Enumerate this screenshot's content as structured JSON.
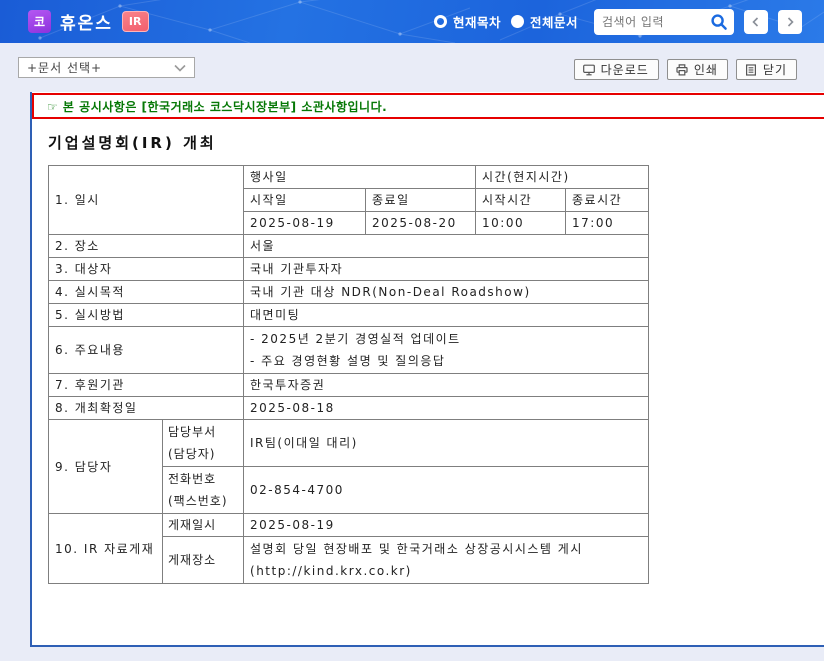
{
  "header": {
    "market_badge": "코",
    "company_name": "휴온스",
    "ir_badge": "IR",
    "radio_current_label": "현재목차",
    "radio_all_label": "전체문서",
    "search_placeholder": "검색어 입력"
  },
  "toolbar": {
    "document_select_label": "+문서 선택+",
    "download_label": "다운로드",
    "print_label": "인쇄",
    "close_label": "닫기"
  },
  "notice": {
    "text": "☞ 본 공시사항은 [한국거래소 코스닥시장본부] 소관사항입니다."
  },
  "doc": {
    "title": "기업설명회(IR) 개최",
    "table": {
      "row1": {
        "label": "1. 일시",
        "event_date_header": "행사일",
        "time_header": "시간(현지시간)",
        "start_date_label": "시작일",
        "end_date_label": "종료일",
        "start_time_label": "시작시간",
        "end_time_label": "종료시간",
        "start_date": "2025-08-19",
        "end_date": "2025-08-20",
        "start_time": "10:00",
        "end_time": "17:00"
      },
      "row2": {
        "label": "2. 장소",
        "value": "서울"
      },
      "row3": {
        "label": "3. 대상자",
        "value": "국내 기관투자자"
      },
      "row4": {
        "label": "4. 실시목적",
        "value": "국내 기관 대상 NDR(Non-Deal Roadshow)"
      },
      "row5": {
        "label": "5. 실시방법",
        "value": "대면미팅"
      },
      "row6": {
        "label": "6. 주요내용",
        "line1": "- 2025년 2분기 경영실적 업데이트",
        "line2": "- 주요 경영현황 설명 및 질의응답"
      },
      "row7": {
        "label": "7. 후원기관",
        "value": "한국투자증권"
      },
      "row8": {
        "label": "8. 개최확정일",
        "value": "2025-08-18"
      },
      "row9": {
        "label": "9. 담당자",
        "dept_label_line1": "담당부서",
        "dept_label_line2": "(담당자)",
        "dept_value": "IR팀(이대일 대리)",
        "phone_label_line1": "전화번호",
        "phone_label_line2": "(팩스번호)",
        "phone_value": "02-854-4700"
      },
      "row10": {
        "label": "10. IR 자료게재",
        "date_label": "게재일시",
        "date_value": "2025-08-19",
        "place_label": "게재장소",
        "place_line1": "설명회 당일 현장배포 및 한국거래소 상장공시시스템 게시",
        "place_line2": "(http://kind.krx.co.kr)"
      }
    }
  },
  "icons": {
    "search-icon": "🔍",
    "prev-icon": "‹",
    "next-icon": "›",
    "dropdown-chevron-icon": "⌄",
    "download-icon": "🖵",
    "print-icon": "⎙",
    "close-icon": "🗎",
    "pointing-hand-icon": "☞"
  },
  "colors": {
    "header_blue": "#2068de",
    "kosdaq_badge_purple": "#a04ae8",
    "ir_badge_pink": "#f4717c",
    "toolbar_bg": "#e9ecf7",
    "panel_border_blue": "#2e5fb5",
    "notice_border_red": "#e60000",
    "notice_text_green": "#067806",
    "table_border_gray": "#7f7f7f"
  }
}
